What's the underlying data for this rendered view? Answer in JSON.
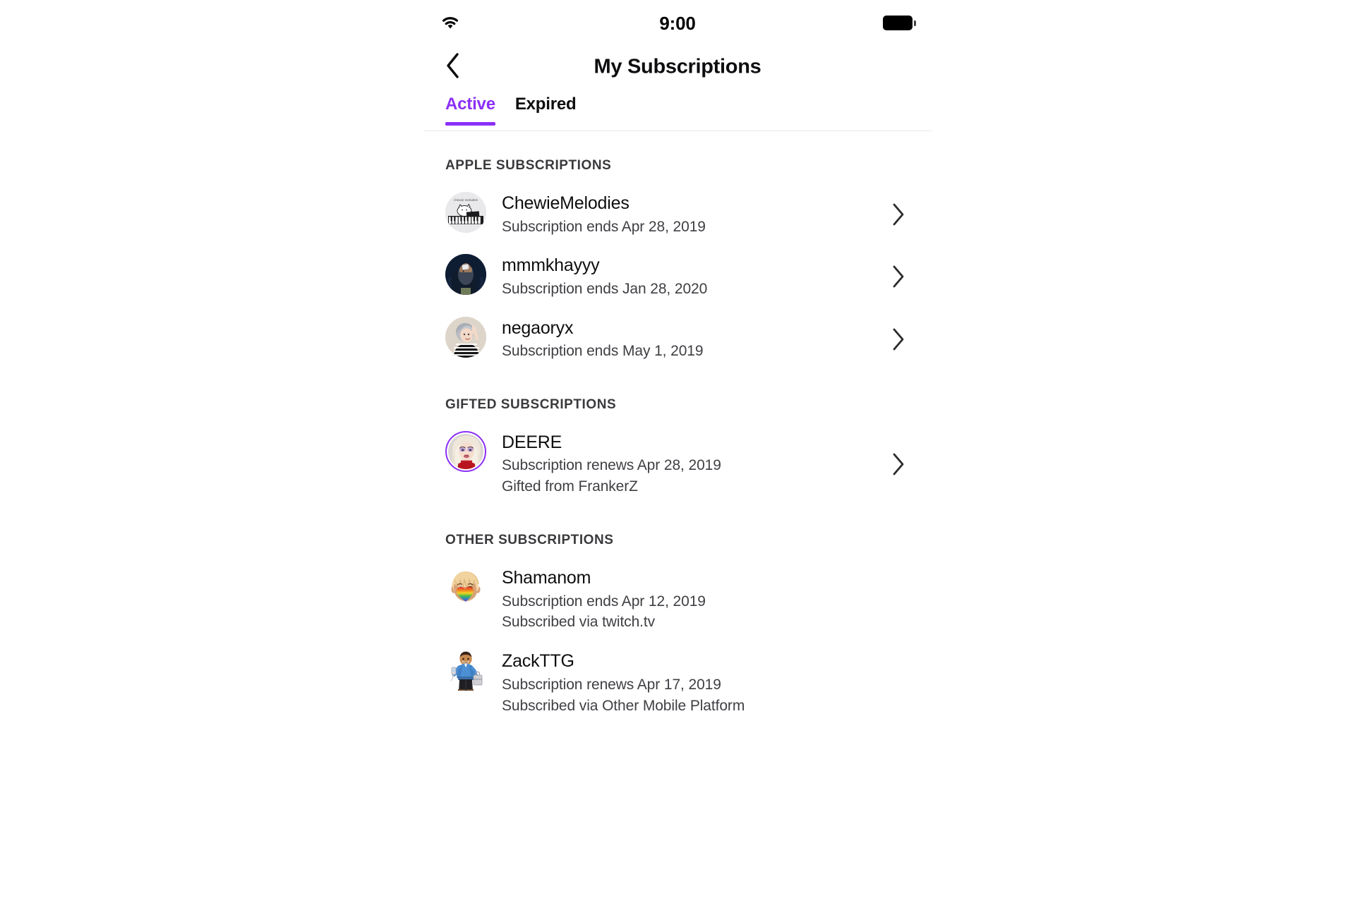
{
  "status_bar": {
    "wifi_icon": "wifi-icon",
    "time": "9:00",
    "battery_icon": "battery-full-icon"
  },
  "header": {
    "back_icon": "chevron-left-icon",
    "title": "My Subscriptions"
  },
  "tabs": [
    {
      "label": "Active",
      "active": true
    },
    {
      "label": "Expired",
      "active": false
    }
  ],
  "accent_color": "#8b2ff7",
  "sections": [
    {
      "title": "APPLE SUBSCRIPTIONS",
      "rows": [
        {
          "name": "ChewieMelodies",
          "sub": "Subscription ends Apr 28, 2019",
          "sub2": "",
          "chevron": true,
          "avatar": "chewiemelodies-avatar"
        },
        {
          "name": "mmmkhayyy",
          "sub": "Subscription ends Jan 28, 2020",
          "sub2": "",
          "chevron": true,
          "avatar": "mmmkhayyy-avatar"
        },
        {
          "name": "negaoryx",
          "sub": "Subscription ends May 1, 2019",
          "sub2": "",
          "chevron": true,
          "avatar": "negaoryx-avatar"
        }
      ]
    },
    {
      "title": "GIFTED SUBSCRIPTIONS",
      "rows": [
        {
          "name": "DEERE",
          "sub": "Subscription renews Apr 28, 2019",
          "sub2": "Gifted from FrankerZ",
          "chevron": true,
          "avatar": "deere-avatar"
        }
      ]
    },
    {
      "title": "OTHER SUBSCRIPTIONS",
      "rows": [
        {
          "name": "Shamanom",
          "sub": "Subscription ends Apr 12, 2019",
          "sub2": "Subscribed via twitch.tv",
          "chevron": false,
          "avatar": "shamanom-avatar"
        },
        {
          "name": "ZackTTG",
          "sub": "Subscription renews Apr 17, 2019",
          "sub2": "Subscribed via Other Mobile Platform",
          "chevron": false,
          "avatar": "zackttg-avatar"
        }
      ]
    }
  ]
}
